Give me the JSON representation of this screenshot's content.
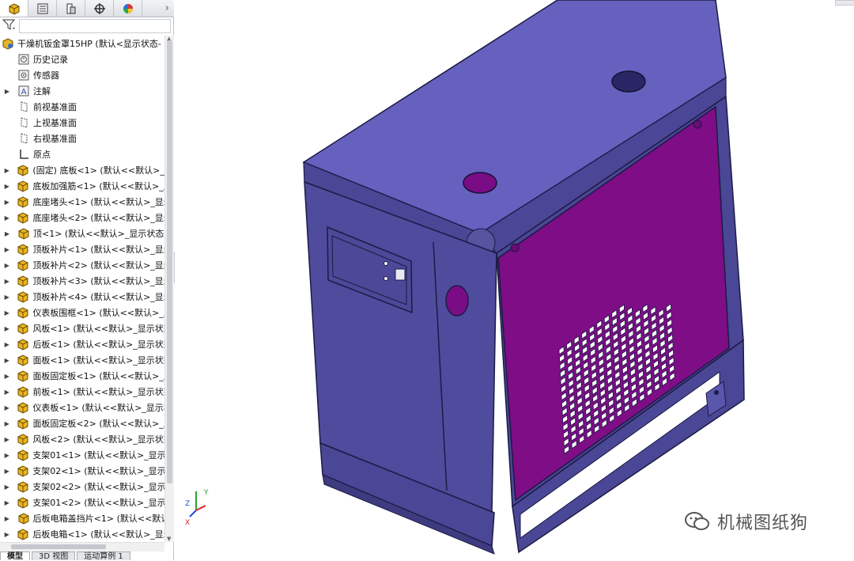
{
  "panel_tabs": [
    "feature-manager-icon",
    "property-manager-icon",
    "configuration-manager-icon",
    "dimxpert-icon",
    "display-manager-icon"
  ],
  "tree": {
    "root": "干燥机钣金罩15HP  (默认<显示状态-",
    "children": [
      "历史记录",
      "传感器",
      "注解",
      "前视基准面",
      "上视基准面",
      "右视基准面",
      "原点"
    ],
    "parts": [
      "(固定) 底板<1> (默认<<默认>_显",
      "底板加强筋<1> (默认<<默认>_显",
      "底座堵头<1> (默认<<默认>_显示",
      "底座堵头<2> (默认<<默认>_显示",
      "顶<1> (默认<<默认>_显示状态",
      "顶板补片<1> (默认<<默认>_显示",
      "顶板补片<2> (默认<<默认>_显示",
      "顶板补片<3> (默认<<默认>_显示",
      "顶板补片<4> (默认<<默认>_显示",
      "仪表板围框<1> (默认<<默认>_显",
      "风板<1> (默认<<默认>_显示状态",
      "后板<1> (默认<<默认>_显示状态",
      "面板<1> (默认<<默认>_显示状态",
      "面板固定板<1> (默认<<默认>_显",
      "前板<1> (默认<<默认>_显示状态",
      "仪表板<1> (默认<<默认>_显示状",
      "面板固定板<2> (默认<<默认>_显",
      "风板<2> (默认<<默认>_显示状态",
      "支架01<1> (默认<<默认>_显示状",
      "支架02<1> (默认<<默认>_显示状",
      "支架02<2> (默认<<默认>_显示状",
      "支架01<2> (默认<<默认>_显示状",
      "后板电箱盖挡片<1> (默认<<默认",
      "后板电箱<1> (默认<<默认>_显示"
    ]
  },
  "bottom_tabs": [
    "模型",
    "3D 视图",
    "运动算例 1"
  ],
  "triad_labels": {
    "x": "X",
    "y": "Y",
    "z": "Z"
  },
  "watermark": "机械图纸狗",
  "colors": {
    "body": "#5b58b4",
    "panel": "#7e0d86",
    "edge": "#1c1a44",
    "accent_yellow": "#e8b424"
  }
}
